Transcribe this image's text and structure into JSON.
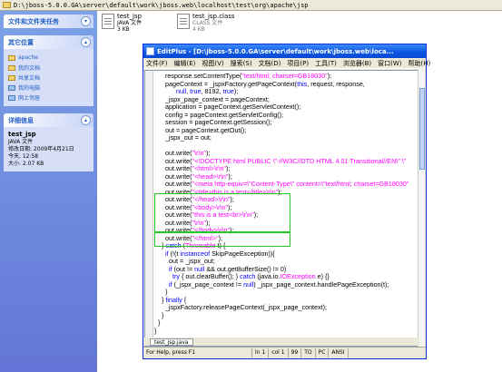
{
  "address": {
    "path": "D:\\jboss-5.0.0.GA\\server\\default\\work\\jboss.web\\localhost\\test\\org\\apache\\jsp"
  },
  "left_pane": {
    "tasks_title": "文件和文件夹任务",
    "other_title": "其它位置",
    "other_links": [
      "apache",
      "我的文档",
      "共享文档",
      "我的电脑",
      "网上邻居"
    ],
    "details_title": "详细信息",
    "details_name": "test_jsp",
    "details_lines": [
      "JAVA 文件",
      "修改日期: 2009年4月21日",
      "今天, 12:58",
      "大小: 2.07 KB"
    ]
  },
  "files": [
    {
      "name": "test_jsp",
      "type": "JAVA 文件",
      "size": "3 KB"
    },
    {
      "name": "test_jsp.class",
      "type": "CLASS 文件",
      "size": "4 KB"
    }
  ],
  "editor": {
    "title": "EditPlus - [D:\\jboss-5.0.0.GA\\server\\default\\work\\jboss.web\\loca...",
    "menu": [
      "文件(F)",
      "编辑(E)",
      "视图(V)",
      "搜索(S)",
      "文档(D)",
      "项目(P)",
      "工具(T)",
      "浏览器(B)",
      "窗口(W)",
      "帮助(H)"
    ],
    "tab_label": "test_jsp.java",
    "status": {
      "help": "For Help, press F1",
      "ln": "ln 1",
      "col": "col 1",
      "lines": "99",
      "f1": "TO",
      "f2": "PC",
      "enc": "ANSI"
    },
    "colors": {
      "keyword": "#0000ff",
      "string": "#ff00ff",
      "plain": "#000000",
      "highlight": "#22c822"
    },
    "code_lines": [
      [
        [
          "      response.setContentType(",
          "p"
        ],
        [
          "\"text/html; charset=GB18030\"",
          "s"
        ],
        [
          ");",
          "p"
        ]
      ],
      [
        [
          "      pageContext = _jspxFactory.getPageContext(",
          "p"
        ],
        [
          "this",
          "k"
        ],
        [
          ", request, response,",
          "p"
        ]
      ],
      [
        [
          "            null",
          "k"
        ],
        [
          ", ",
          "p"
        ],
        [
          "true",
          "k"
        ],
        [
          ", 8192, ",
          "p"
        ],
        [
          "true",
          "k"
        ],
        [
          ");",
          "p"
        ]
      ],
      [
        [
          "      _jspx_page_context = pageContext;",
          "p"
        ]
      ],
      [
        [
          "      application = pageContext.getServletContext();",
          "p"
        ]
      ],
      [
        [
          "      config = pageContext.getServletConfig();",
          "p"
        ]
      ],
      [
        [
          "      session = pageContext.getSession();",
          "p"
        ]
      ],
      [
        [
          "      out = pageContext.getOut();",
          "p"
        ]
      ],
      [
        [
          "      _jspx_out = out;",
          "p"
        ]
      ],
      [
        [
          "",
          "p"
        ]
      ],
      [
        [
          "      out.write(",
          "p"
        ],
        [
          "\"\\r\\n\"",
          "s"
        ],
        [
          ");",
          "p"
        ]
      ],
      [
        [
          "      out.write(",
          "p"
        ],
        [
          "\"<!DOCTYPE html PUBLIC \\\"-//W3C//DTD HTML 4.01 Transitional//EN\\\" \\\"",
          "s"
        ]
      ],
      [
        [
          "      out.write(",
          "p"
        ],
        [
          "\"<html>\\r\\n\"",
          "s"
        ],
        [
          ");",
          "p"
        ]
      ],
      [
        [
          "      out.write(",
          "p"
        ],
        [
          "\"<head>\\r\\n\"",
          "s"
        ],
        [
          ");",
          "p"
        ]
      ],
      [
        [
          "      out.write(",
          "p"
        ],
        [
          "\"<meta http-equiv=\\\"Content-Type\\\" content=\\\"text/html; charset=GB18030\"",
          "s"
        ]
      ],
      [
        [
          "      out.write(",
          "p"
        ],
        [
          "\"<title>this is a test</title>\\r\\n\"",
          "s"
        ],
        [
          ");",
          "p"
        ]
      ],
      [
        [
          "      out.write(",
          "p"
        ],
        [
          "\"</head>\\r\\n\"",
          "s"
        ],
        [
          ");",
          "p"
        ]
      ],
      [
        [
          "      out.write(",
          "p"
        ],
        [
          "\"<body>\\r\\n\"",
          "s"
        ],
        [
          ");",
          "p"
        ]
      ],
      [
        [
          "      out.write(",
          "p"
        ],
        [
          "\"this is a test<br>\\r\\n\"",
          "s"
        ],
        [
          ");",
          "p"
        ]
      ],
      [
        [
          "      out.write(",
          "p"
        ],
        [
          "\"\\r\\n\"",
          "s"
        ],
        [
          ");",
          "p"
        ]
      ],
      [
        [
          "      out.write(",
          "p"
        ],
        [
          "\"</body>\\r\\n\"",
          "s"
        ],
        [
          ");",
          "p"
        ]
      ],
      [
        [
          "      out.write(",
          "p"
        ],
        [
          "\"</html>\"",
          "s"
        ],
        [
          ");",
          "p"
        ]
      ],
      [
        [
          "    } ",
          "p"
        ],
        [
          "catch",
          "k"
        ],
        [
          " (",
          "p"
        ],
        [
          "Throwable",
          "s"
        ],
        [
          " t) {",
          "p"
        ]
      ],
      [
        [
          "      ",
          "p"
        ],
        [
          "if",
          "k"
        ],
        [
          " (!(t ",
          "p"
        ],
        [
          "instanceof",
          "k"
        ],
        [
          " SkipPageException)){",
          "p"
        ]
      ],
      [
        [
          "        out = _jspx_out;",
          "p"
        ]
      ],
      [
        [
          "        ",
          "p"
        ],
        [
          "if",
          "k"
        ],
        [
          " (out != ",
          "p"
        ],
        [
          "null",
          "k"
        ],
        [
          " && out.getBufferSize() != 0)",
          "p"
        ]
      ],
      [
        [
          "          ",
          "p"
        ],
        [
          "try",
          "k"
        ],
        [
          " { out.clearBuffer(); } ",
          "p"
        ],
        [
          "catch",
          "k"
        ],
        [
          " (java.io.",
          "p"
        ],
        [
          "IOException",
          "s"
        ],
        [
          " e) {}",
          "p"
        ]
      ],
      [
        [
          "        ",
          "p"
        ],
        [
          "if",
          "k"
        ],
        [
          " (_jspx_page_context != ",
          "p"
        ],
        [
          "null",
          "k"
        ],
        [
          ") _jspx_page_context.handlePageException(t);",
          "p"
        ]
      ],
      [
        [
          "      }",
          "p"
        ]
      ],
      [
        [
          "    } ",
          "p"
        ],
        [
          "finally",
          "k"
        ],
        [
          " {",
          "p"
        ]
      ],
      [
        [
          "      _jspxFactory.releasePageContext(_jspx_page_context);",
          "p"
        ]
      ],
      [
        [
          "    }",
          "p"
        ]
      ],
      [
        [
          "  }",
          "p"
        ]
      ],
      [
        [
          "}",
          "p"
        ]
      ]
    ]
  }
}
